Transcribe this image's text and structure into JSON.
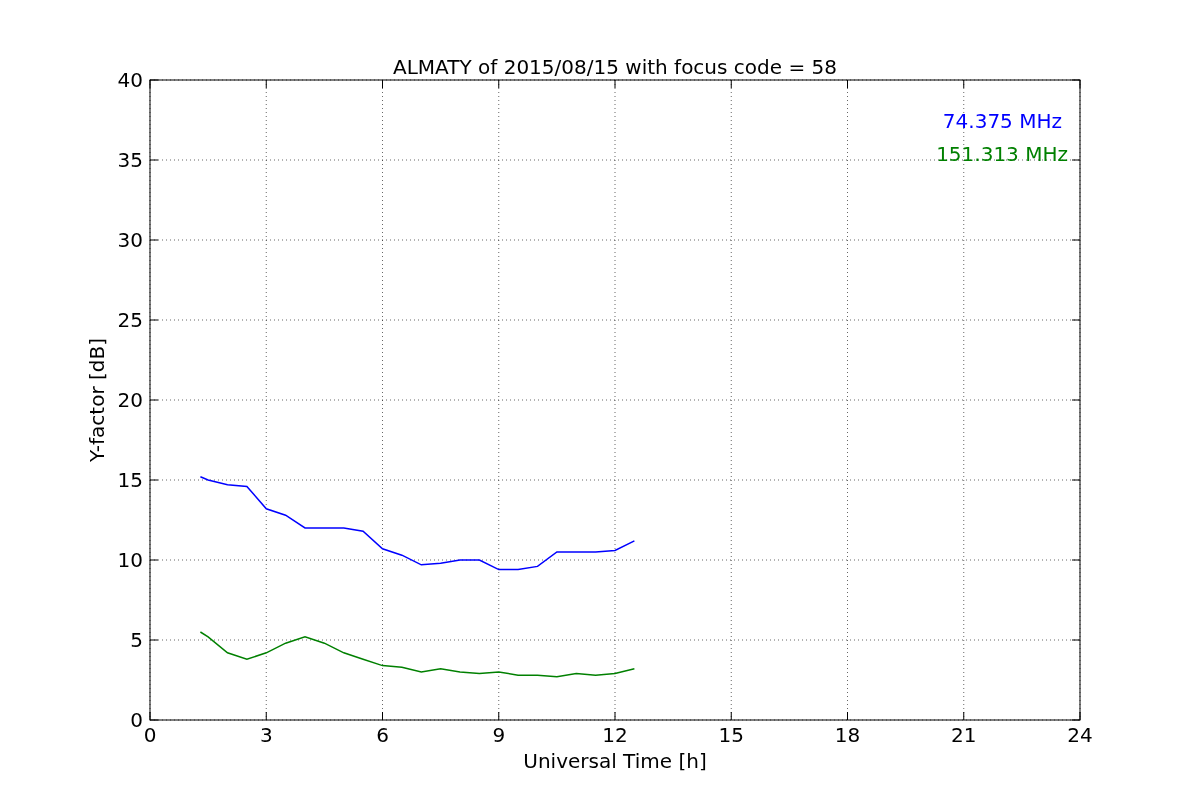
{
  "chart_data": {
    "type": "line",
    "title": "ALMATY of 2015/08/15 with focus code = 58",
    "xlabel": "Universal Time [h]",
    "ylabel": "Y-factor [dB]",
    "x": [
      1.3,
      1.5,
      2,
      2.5,
      3,
      3.5,
      4,
      4.5,
      5,
      5.5,
      6,
      6.5,
      7,
      7.5,
      8,
      8.5,
      9,
      9.5,
      10,
      10.5,
      11,
      11.5,
      12,
      12.5
    ],
    "series": [
      {
        "name": "74.375 MHz",
        "color": "#0000ff",
        "values": [
          15.2,
          15.0,
          14.7,
          14.6,
          13.2,
          12.8,
          12.0,
          12.0,
          12.0,
          11.8,
          10.7,
          10.3,
          9.7,
          9.8,
          10.0,
          10.0,
          9.4,
          9.4,
          9.6,
          10.5,
          10.5,
          10.5,
          10.6,
          11.2
        ]
      },
      {
        "name": "151.313 MHz",
        "color": "#008000",
        "values": [
          5.5,
          5.2,
          4.2,
          3.8,
          4.2,
          4.8,
          5.2,
          4.8,
          4.2,
          3.8,
          3.4,
          3.3,
          3.0,
          3.2,
          3.0,
          2.9,
          3.0,
          2.8,
          2.8,
          2.7,
          2.9,
          2.8,
          2.9,
          3.2
        ]
      }
    ],
    "grid": true,
    "xlim": [
      0,
      24
    ],
    "ylim": [
      0,
      40
    ],
    "xticks": [
      0,
      3,
      6,
      9,
      12,
      15,
      18,
      21,
      24
    ],
    "yticks": [
      0,
      5,
      10,
      15,
      20,
      25,
      30,
      35,
      40
    ]
  }
}
